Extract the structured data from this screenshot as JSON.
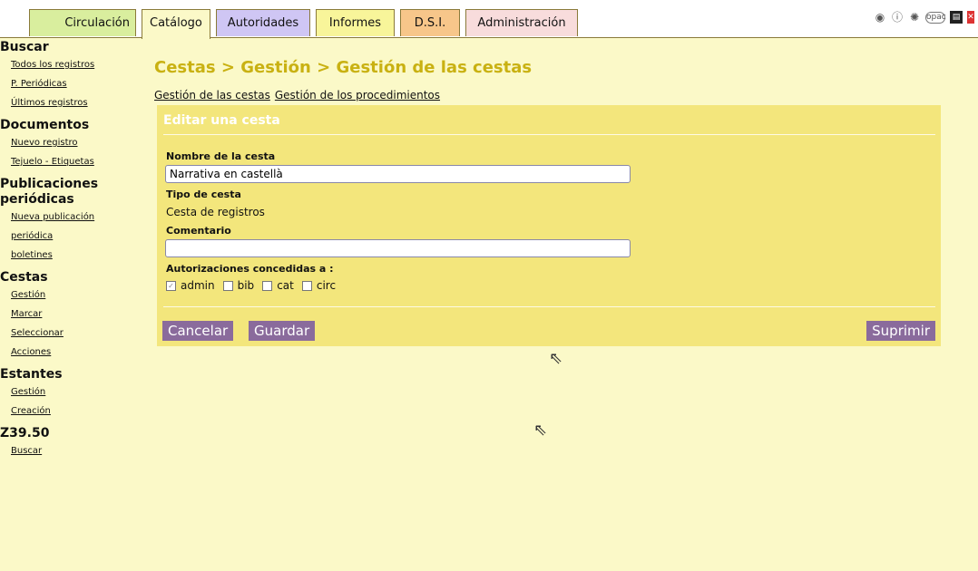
{
  "tabs": [
    {
      "label": "Circulación",
      "color": "#d9ee9e"
    },
    {
      "label": "Catálogo",
      "color": "#fbf9c8"
    },
    {
      "label": "Autoridades",
      "color": "#cfc6f4"
    },
    {
      "label": "Informes",
      "color": "#f8f59a"
    },
    {
      "label": "D.S.I.",
      "color": "#f7c68a"
    },
    {
      "label": "Administración",
      "color": "#f8dcdc"
    }
  ],
  "top_icons": {
    "opac": "opac"
  },
  "sidebar": {
    "buscar": {
      "title": "Buscar",
      "items": [
        "Todos los registros",
        "P. Periódicas",
        "Últimos registros"
      ]
    },
    "documentos": {
      "title": "Documentos",
      "items": [
        "Nuevo registro",
        "Tejuelo - Etiquetas"
      ]
    },
    "publicaciones": {
      "title1": "Publicaciones",
      "title2": "periódicas",
      "items": [
        "Nueva publicación",
        "periódica",
        "boletines"
      ]
    },
    "cestas": {
      "title": "Cestas",
      "items": [
        "Gestión",
        "Marcar",
        "Seleccionar",
        "Acciones"
      ]
    },
    "estantes": {
      "title": "Estantes",
      "items": [
        "Gestión",
        "Creación"
      ]
    },
    "z3950": {
      "title": "Z39.50",
      "items": [
        "Buscar"
      ]
    }
  },
  "main": {
    "title": "Cestas > Gestión > Gestión de las cestas",
    "crumbs": [
      "Gestión de las cestas",
      "Gestión de los procedimientos"
    ],
    "panel": {
      "title": "Editar una cesta",
      "name_label": "Nombre de la cesta",
      "name_value": "Narrativa en castellà",
      "type_label": "Tipo de cesta",
      "type_value": "Cesta de registros",
      "comment_label": "Comentario",
      "comment_value": "",
      "auth_label": "Autorizaciones concedidas a :",
      "auth": [
        {
          "label": "admin",
          "checked": true
        },
        {
          "label": "bib",
          "checked": false
        },
        {
          "label": "cat",
          "checked": false
        },
        {
          "label": "circ",
          "checked": false
        }
      ],
      "cancel": "Cancelar",
      "save": "Guardar",
      "delete": "Suprimir"
    }
  },
  "colors": {
    "accent_title": "#c9b112",
    "panel": "#f3e67c",
    "button": "#8a6b9c",
    "background": "#fbf9c8"
  }
}
